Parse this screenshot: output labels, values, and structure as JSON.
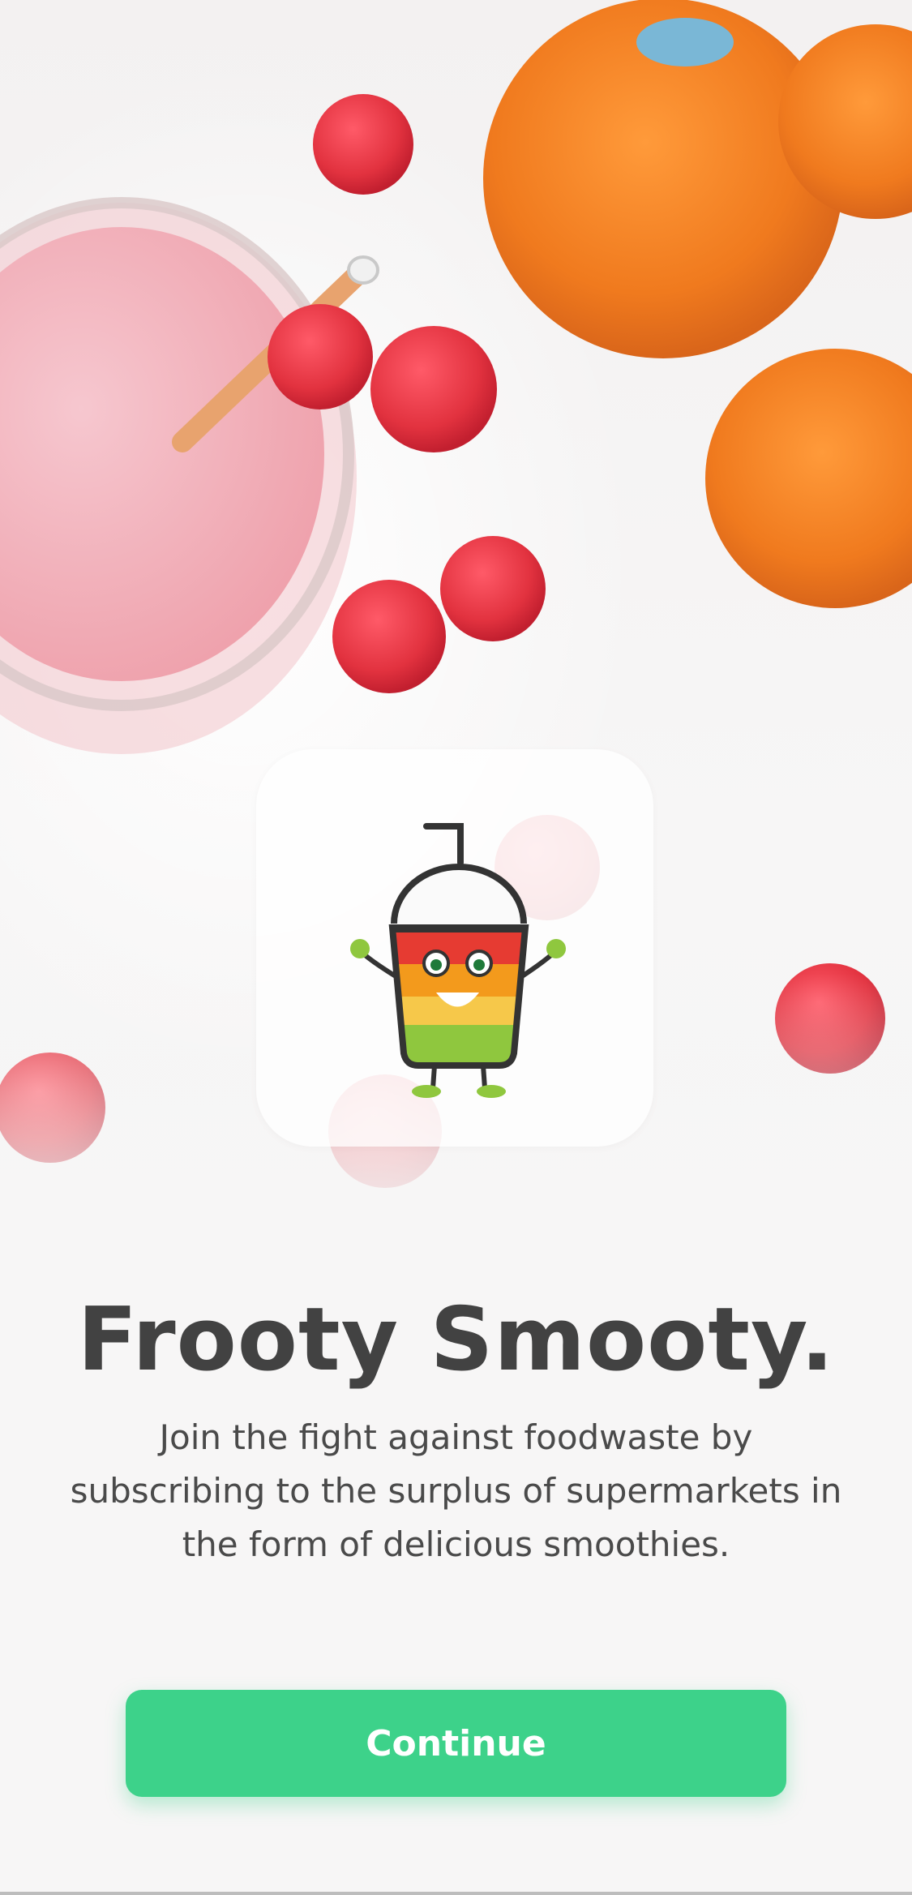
{
  "app": {
    "title": "Frooty Smooty.",
    "description": "Join the fight against foodwaste by subscribing to the surplus of supermarkets in the form of delicious smoothies.",
    "continue_label": "Continue"
  },
  "background": {
    "image_subject": "smoothie-with-raspberries-and-oranges-photo"
  },
  "logo": {
    "icon_name": "smoothie-cup-mascot-icon"
  },
  "colors": {
    "accent": "#3DD28A",
    "title_text": "#424242",
    "body_text": "#4A4A4A",
    "button_text": "#FFFFFF"
  }
}
